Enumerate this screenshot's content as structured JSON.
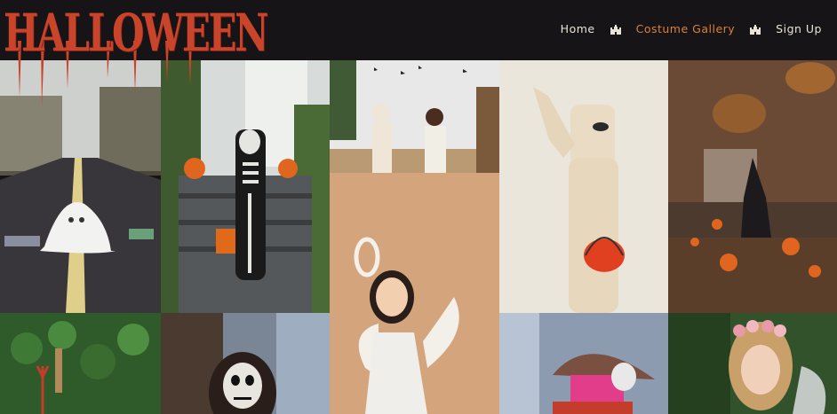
{
  "logo": {
    "text": "HALLOWEEN"
  },
  "nav": {
    "items": [
      {
        "label": "Home",
        "active": false
      },
      {
        "label": "Costume Gallery",
        "active": true
      },
      {
        "label": "Sign Up",
        "active": false
      }
    ],
    "separator_icon": "castle-icon"
  },
  "colors": {
    "background": "#161416",
    "logo": "#c8442a",
    "nav_text": "#e9e2d6",
    "nav_active": "#d9813e"
  },
  "gallery": {
    "photos": [
      {
        "subject": "ghost-costume-on-road"
      },
      {
        "subject": "skeleton-costume-on-porch"
      },
      {
        "subject": "two-kids-mummy-costumes"
      },
      {
        "subject": "kid-mummy-with-pumpkin-bucket"
      },
      {
        "subject": "witch-in-pumpkin-field"
      },
      {
        "subject": "angel-costume-girl"
      },
      {
        "subject": "garden-decorations"
      },
      {
        "subject": "skull-face-paint"
      },
      {
        "subject": "clown-hat-costume"
      },
      {
        "subject": "girl-flower-crown"
      }
    ]
  }
}
